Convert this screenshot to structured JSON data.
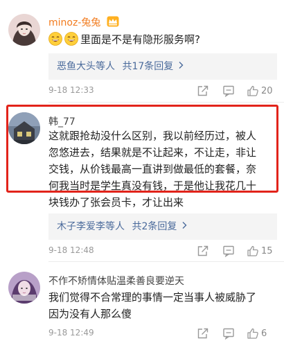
{
  "comments": [
    {
      "username": "minoz-兔兔",
      "text": "里面是不是有隐形服务啊?",
      "reply_users": "恶鱼大头等人",
      "reply_count_text": "共17条回复",
      "time": "9-18 12:33",
      "like_count": "20"
    },
    {
      "username": "韩_77",
      "text_lines": [
        "这就跟抢劫没什么区别，我以前经历过，被人",
        "忽悠进去，结果就是不让起来，不让走，非让",
        "交钱，从价钱最高一直讲到做最低的套餐，奈",
        "何我当时是学生真没有钱，于是他让我花几十",
        "块钱办了张会员卡，才让出来"
      ],
      "reply_users": "木子李爱李等人",
      "reply_count_text": "共2条回复",
      "time": "9-18 12:48",
      "like_count": "15"
    },
    {
      "username": "不作不矫情体贴温柔善良要逆天",
      "text_lines": [
        "我们觉得不合常理的事情一定当事人被威胁了",
        "因为没有人那么傻"
      ],
      "time": "9-18 12:49",
      "like_count": "6"
    }
  ],
  "colors": {
    "highlight_border": "#e2231a",
    "username_vip": "#f27b1e",
    "reply_link": "#4a6a9b",
    "meta_gray": "#999999"
  },
  "icons": [
    "share-icon",
    "comment-icon",
    "like-icon",
    "vip-crown-icon",
    "grin-emoji-icon"
  ]
}
